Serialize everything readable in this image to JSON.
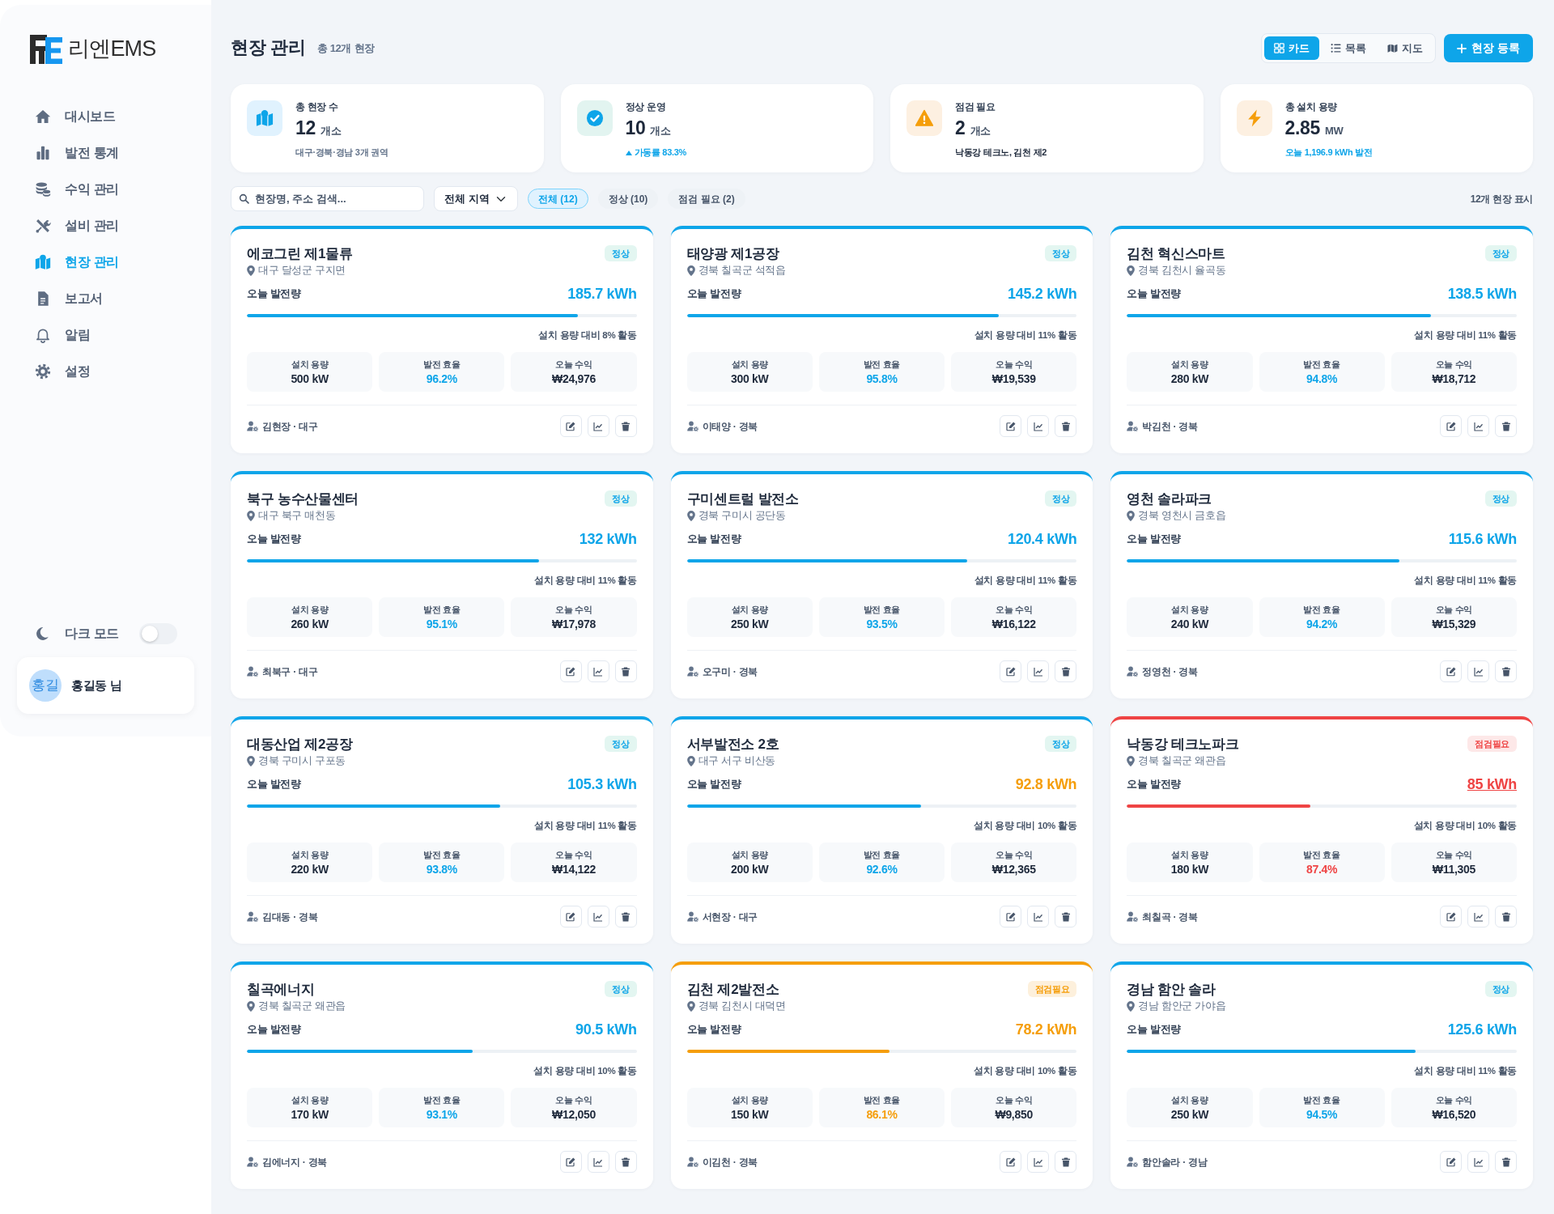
{
  "sidebar": {
    "brand": "리엔EMS",
    "nav": [
      {
        "label": "대시보드",
        "selected": false
      },
      {
        "label": "발전 통계",
        "selected": false
      },
      {
        "label": "수익 관리",
        "selected": false
      },
      {
        "label": "설비 관리",
        "selected": false
      },
      {
        "label": "현장 관리",
        "selected": true
      },
      {
        "label": "보고서",
        "selected": false
      },
      {
        "label": "알림",
        "selected": false
      },
      {
        "label": "설정",
        "selected": false
      }
    ],
    "dark_mode": {
      "label": "다크 모드",
      "on": false
    },
    "user": {
      "avatar": "홍길",
      "name": "홍길동 님"
    }
  },
  "header": {
    "title": "현장 관리",
    "subtitle": "총 12개 현장",
    "views": [
      {
        "label": "카드",
        "selected": true
      },
      {
        "label": "목록",
        "selected": false
      },
      {
        "label": "지도",
        "selected": false
      }
    ],
    "add_button": "현장 등록"
  },
  "stats": [
    {
      "kind": "total",
      "label": "총 현장 수",
      "value": "12",
      "unit": "개소",
      "note": "대구·경북·경남 3개 권역"
    },
    {
      "kind": "normal",
      "label": "정상 운영",
      "value": "10",
      "unit": "개소",
      "note": "가동률 83.3%"
    },
    {
      "kind": "warning",
      "label": "점검 필요",
      "value": "2",
      "unit": "개소",
      "note": "낙동강 테크노, 김천 제2"
    },
    {
      "kind": "capacity",
      "label": "총 설치 용량",
      "value": "2.85",
      "unit": "MW",
      "note": "오늘 1,196.9 kWh 발전"
    }
  ],
  "filters": {
    "search": {
      "placeholder": "현장명, 주소 검색..."
    },
    "region": {
      "value": "전체 지역"
    },
    "chips": [
      {
        "label": "전체 (12)",
        "selected": true
      },
      {
        "label": "정상 (10)",
        "selected": false
      },
      {
        "label": "점검 필요 (2)",
        "selected": false
      }
    ],
    "result_count": "12개 현장 표시"
  },
  "sites": [
    {
      "name": "에코그린 제1물류",
      "address": "대구 달성군 구지면",
      "status": {
        "label": "정상",
        "kind": "normal"
      },
      "output_label": "오늘 발전량",
      "output": {
        "value": "185.7 kWh",
        "kind": "normal"
      },
      "level": 0.85,
      "utilization": "설치 용량 대비 8% 활동",
      "metrics": [
        {
          "label": "설치 용량",
          "value": "500 kW",
          "kind": "plain"
        },
        {
          "label": "발전 효율",
          "value": "96.2%",
          "kind": "good"
        },
        {
          "label": "오늘 수익",
          "value": "₩24,976",
          "kind": "plain"
        }
      ],
      "manager": "김현장 · 대구"
    },
    {
      "name": "태양광 제1공장",
      "address": "경북 칠곡군 석적읍",
      "status": {
        "label": "정상",
        "kind": "normal"
      },
      "output_label": "오늘 발전량",
      "output": {
        "value": "145.2 kWh",
        "kind": "normal"
      },
      "level": 0.8,
      "utilization": "설치 용량 대비 11% 활동",
      "metrics": [
        {
          "label": "설치 용량",
          "value": "300 kW",
          "kind": "plain"
        },
        {
          "label": "발전 효율",
          "value": "95.8%",
          "kind": "good"
        },
        {
          "label": "오늘 수익",
          "value": "₩19,539",
          "kind": "plain"
        }
      ],
      "manager": "이태양 · 경북"
    },
    {
      "name": "김천 혁신스마트",
      "address": "경북 김천시 율곡동",
      "status": {
        "label": "정상",
        "kind": "normal"
      },
      "output_label": "오늘 발전량",
      "output": {
        "value": "138.5 kWh",
        "kind": "normal"
      },
      "level": 0.78,
      "utilization": "설치 용량 대비 11% 활동",
      "metrics": [
        {
          "label": "설치 용량",
          "value": "280 kW",
          "kind": "plain"
        },
        {
          "label": "발전 효율",
          "value": "94.8%",
          "kind": "good"
        },
        {
          "label": "오늘 수익",
          "value": "₩18,712",
          "kind": "plain"
        }
      ],
      "manager": "박김천 · 경북"
    },
    {
      "name": "북구 농수산물센터",
      "address": "대구 북구 매천동",
      "status": {
        "label": "정상",
        "kind": "normal"
      },
      "output_label": "오늘 발전량",
      "output": {
        "value": "132 kWh",
        "kind": "normal"
      },
      "level": 0.75,
      "utilization": "설치 용량 대비 11% 활동",
      "metrics": [
        {
          "label": "설치 용량",
          "value": "260 kW",
          "kind": "plain"
        },
        {
          "label": "발전 효율",
          "value": "95.1%",
          "kind": "good"
        },
        {
          "label": "오늘 수익",
          "value": "₩17,978",
          "kind": "plain"
        }
      ],
      "manager": "최북구 · 대구"
    },
    {
      "name": "구미센트럴 발전소",
      "address": "경북 구미시 공단동",
      "status": {
        "label": "정상",
        "kind": "normal"
      },
      "output_label": "오늘 발전량",
      "output": {
        "value": "120.4 kWh",
        "kind": "normal"
      },
      "level": 0.72,
      "utilization": "설치 용량 대비 11% 활동",
      "metrics": [
        {
          "label": "설치 용량",
          "value": "250 kW",
          "kind": "plain"
        },
        {
          "label": "발전 효율",
          "value": "93.5%",
          "kind": "good"
        },
        {
          "label": "오늘 수익",
          "value": "₩16,122",
          "kind": "plain"
        }
      ],
      "manager": "오구미 · 경북"
    },
    {
      "name": "영천 솔라파크",
      "address": "경북 영천시 금호읍",
      "status": {
        "label": "정상",
        "kind": "normal"
      },
      "output_label": "오늘 발전량",
      "output": {
        "value": "115.6 kWh",
        "kind": "normal"
      },
      "level": 0.7,
      "utilization": "설치 용량 대비 11% 활동",
      "metrics": [
        {
          "label": "설치 용량",
          "value": "240 kW",
          "kind": "plain"
        },
        {
          "label": "발전 효율",
          "value": "94.2%",
          "kind": "good"
        },
        {
          "label": "오늘 수익",
          "value": "₩15,329",
          "kind": "plain"
        }
      ],
      "manager": "정영천 · 경북"
    },
    {
      "name": "대동산업 제2공장",
      "address": "경북 구미시 구포동",
      "status": {
        "label": "정상",
        "kind": "normal"
      },
      "output_label": "오늘 발전량",
      "output": {
        "value": "105.3 kWh",
        "kind": "normal"
      },
      "level": 0.65,
      "utilization": "설치 용량 대비 11% 활동",
      "metrics": [
        {
          "label": "설치 용량",
          "value": "220 kW",
          "kind": "plain"
        },
        {
          "label": "발전 효율",
          "value": "93.8%",
          "kind": "good"
        },
        {
          "label": "오늘 수익",
          "value": "₩14,122",
          "kind": "plain"
        }
      ],
      "manager": "김대동 · 경북"
    },
    {
      "name": "서부발전소 2호",
      "address": "대구 서구 비산동",
      "status": {
        "label": "정상",
        "kind": "normal"
      },
      "output_label": "오늘 발전량",
      "output": {
        "value": "92.8 kWh",
        "kind": "warning"
      },
      "level": 0.6,
      "utilization": "설치 용량 대비 10% 활동",
      "metrics": [
        {
          "label": "설치 용량",
          "value": "200 kW",
          "kind": "plain"
        },
        {
          "label": "발전 효율",
          "value": "92.6%",
          "kind": "good"
        },
        {
          "label": "오늘 수익",
          "value": "₩12,365",
          "kind": "plain"
        }
      ],
      "manager": "서현장 · 대구"
    },
    {
      "name": "낙동강 테크노파크",
      "address": "경북 칠곡군 왜관읍",
      "status": {
        "label": "점검필요",
        "kind": "danger"
      },
      "output_label": "오늘 발전량",
      "output": {
        "value": "85 kWh",
        "kind": "danger"
      },
      "level": 0.47,
      "utilization": "설치 용량 대비 10% 활동",
      "metrics": [
        {
          "label": "설치 용량",
          "value": "180 kW",
          "kind": "plain"
        },
        {
          "label": "발전 효율",
          "value": "87.4%",
          "kind": "danger"
        },
        {
          "label": "오늘 수익",
          "value": "₩11,305",
          "kind": "plain"
        }
      ],
      "manager": "최칠곡 · 경북"
    },
    {
      "name": "칠곡에너지",
      "address": "경북 칠곡군 왜관읍",
      "status": {
        "label": "정상",
        "kind": "normal"
      },
      "output_label": "오늘 발전량",
      "output": {
        "value": "90.5 kWh",
        "kind": "normal"
      },
      "level": 0.58,
      "utilization": "설치 용량 대비 10% 활동",
      "metrics": [
        {
          "label": "설치 용량",
          "value": "170 kW",
          "kind": "plain"
        },
        {
          "label": "발전 효율",
          "value": "93.1%",
          "kind": "good"
        },
        {
          "label": "오늘 수익",
          "value": "₩12,050",
          "kind": "plain"
        }
      ],
      "manager": "김에너지 · 경북"
    },
    {
      "name": "김천 제2발전소",
      "address": "경북 김천시 대덕면",
      "status": {
        "label": "점검필요",
        "kind": "warning"
      },
      "output_label": "오늘 발전량",
      "output": {
        "value": "78.2 kWh",
        "kind": "warning"
      },
      "level": 0.52,
      "utilization": "설치 용량 대비 10% 활동",
      "metrics": [
        {
          "label": "설치 용량",
          "value": "150 kW",
          "kind": "plain"
        },
        {
          "label": "발전 효율",
          "value": "86.1%",
          "kind": "warning"
        },
        {
          "label": "오늘 수익",
          "value": "₩9,850",
          "kind": "plain"
        }
      ],
      "manager": "이김천 · 경북"
    },
    {
      "name": "경남 함안 솔라",
      "address": "경남 함안군 가야읍",
      "status": {
        "label": "정상",
        "kind": "normal"
      },
      "output_label": "오늘 발전량",
      "output": {
        "value": "125.6 kWh",
        "kind": "normal"
      },
      "level": 0.74,
      "utilization": "설치 용량 대비 11% 활동",
      "metrics": [
        {
          "label": "설치 용량",
          "value": "250 kW",
          "kind": "plain"
        },
        {
          "label": "발전 효율",
          "value": "94.5%",
          "kind": "good"
        },
        {
          "label": "오늘 수익",
          "value": "₩16,520",
          "kind": "plain"
        }
      ],
      "manager": "함안솔라 · 경남"
    }
  ]
}
